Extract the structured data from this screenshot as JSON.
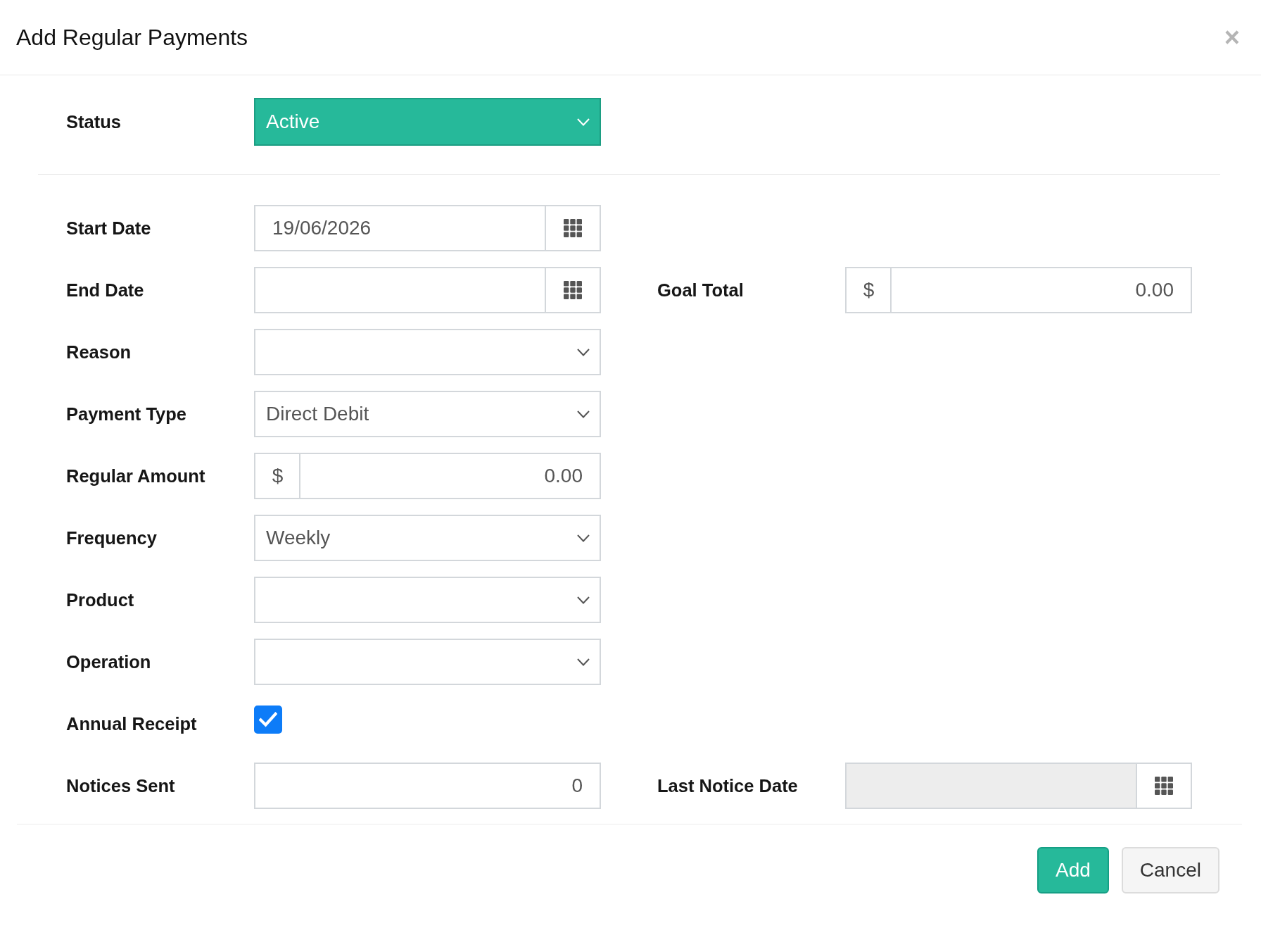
{
  "dialog": {
    "title": "Add Regular Payments",
    "close": "×"
  },
  "status": {
    "label": "Status",
    "value": "Active"
  },
  "rows": [
    {
      "fields": [
        {
          "kind": "date",
          "label": "Start Date",
          "value": "19/06/2026",
          "disabled": false
        }
      ]
    },
    {
      "fields": [
        {
          "kind": "date",
          "label": "End Date",
          "disabled": false
        },
        {
          "kind": "currency",
          "label": "Goal Total",
          "prefix": "$",
          "value": "0.00",
          "disabled": false
        }
      ]
    },
    {
      "fields": [
        {
          "kind": "select",
          "label": "Reason",
          "disabled": false
        }
      ]
    },
    {
      "fields": [
        {
          "kind": "select",
          "label": "Payment Type",
          "value": "Direct Debit",
          "disabled": false
        }
      ]
    },
    {
      "fields": [
        {
          "kind": "currency",
          "label": "Regular Amount",
          "prefix": "$",
          "value": "0.00",
          "disabled": false
        }
      ]
    },
    {
      "fields": [
        {
          "kind": "select",
          "label": "Frequency",
          "value": "Weekly",
          "disabled": false
        }
      ]
    },
    {
      "fields": [
        {
          "kind": "select",
          "label": "Product",
          "disabled": false
        }
      ]
    },
    {
      "fields": [
        {
          "kind": "select",
          "label": "Operation",
          "disabled": false
        }
      ]
    },
    {
      "fields": [
        {
          "kind": "checkbox",
          "label": "Annual Receipt",
          "checked": true,
          "disabled": false
        }
      ]
    },
    {
      "fields": [
        {
          "kind": "number",
          "label": "Notices Sent",
          "value": "0",
          "disabled": false
        },
        {
          "kind": "date",
          "label": "Last Notice Date",
          "disabled": true
        }
      ]
    }
  ],
  "buttons": [
    {
      "label": "Add",
      "kind": "primary"
    },
    {
      "label": "Cancel",
      "kind": "secondary"
    }
  ]
}
